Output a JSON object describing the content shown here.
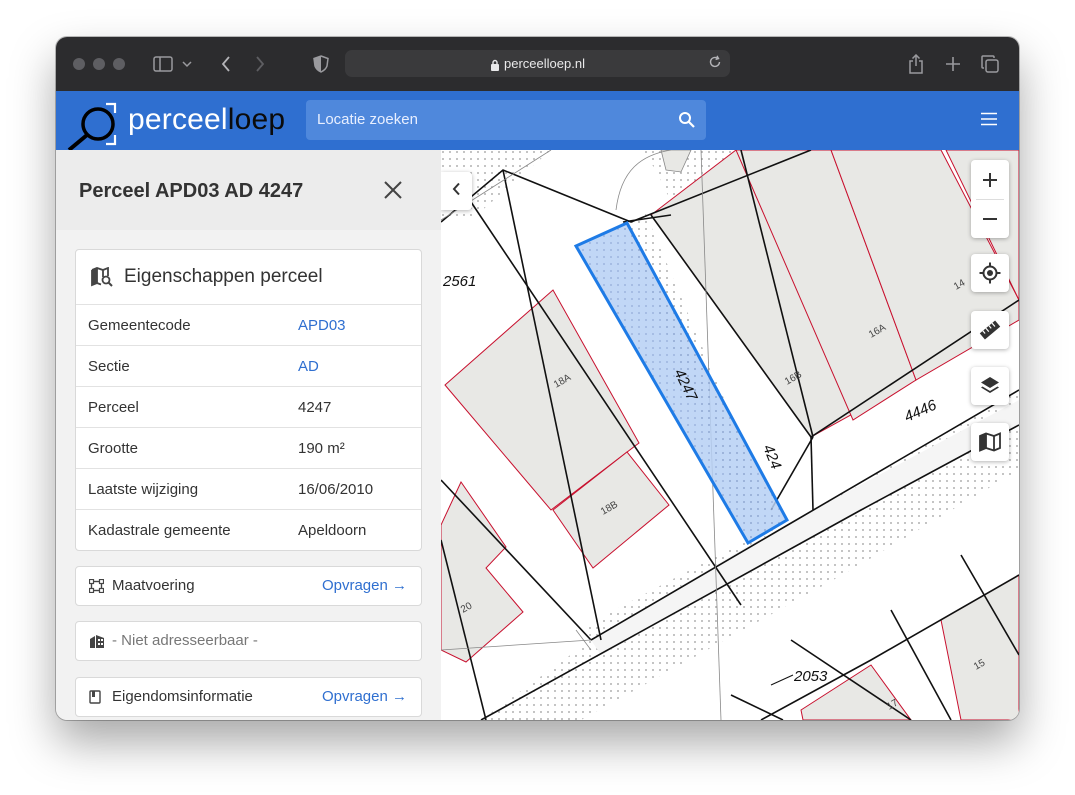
{
  "browser": {
    "url": "perceelloep.nl",
    "icons": [
      "sidebar-icon",
      "chevron-down-icon",
      "back-icon",
      "forward-icon",
      "shield-icon",
      "lock-icon",
      "reload-icon",
      "share-icon",
      "plus-icon",
      "tabs-icon"
    ]
  },
  "header": {
    "logo_prefix": "perceel",
    "logo_suffix": "loep",
    "search_placeholder": "Locatie zoeken"
  },
  "sidebar": {
    "title": "Perceel APD03 AD 4247",
    "properties_title": "Eigenschappen perceel",
    "properties": [
      {
        "key": "Gemeentecode",
        "value": "APD03",
        "link": true
      },
      {
        "key": "Sectie",
        "value": "AD",
        "link": true
      },
      {
        "key": "Perceel",
        "value": "4247",
        "link": false
      },
      {
        "key": "Grootte",
        "value": "190 m²",
        "link": false
      },
      {
        "key": "Laatste wijziging",
        "value": "16/06/2010",
        "link": false
      },
      {
        "key": "Kadastrale gemeente",
        "value": "Apeldoorn",
        "link": false
      }
    ],
    "maatvoering": {
      "label": "Maatvoering",
      "action": "Opvragen →"
    },
    "adres": {
      "label": "- Niet adresseerbaar -"
    },
    "eigendom": {
      "label": "Eigendomsinformatie",
      "action": "Opvragen →"
    }
  },
  "map": {
    "parcel_labels": [
      "2561",
      "4247",
      "4446",
      "424",
      "2053"
    ],
    "building_labels": [
      "18A",
      "18B",
      "20",
      "16B",
      "16A",
      "14",
      "15",
      "17"
    ],
    "selected_parcel": "4247",
    "colors": {
      "header": "#2f6fd0",
      "selection": "#1e7be6",
      "building_outline": "#c8102e",
      "building_fill": "#e8e8e5"
    }
  }
}
